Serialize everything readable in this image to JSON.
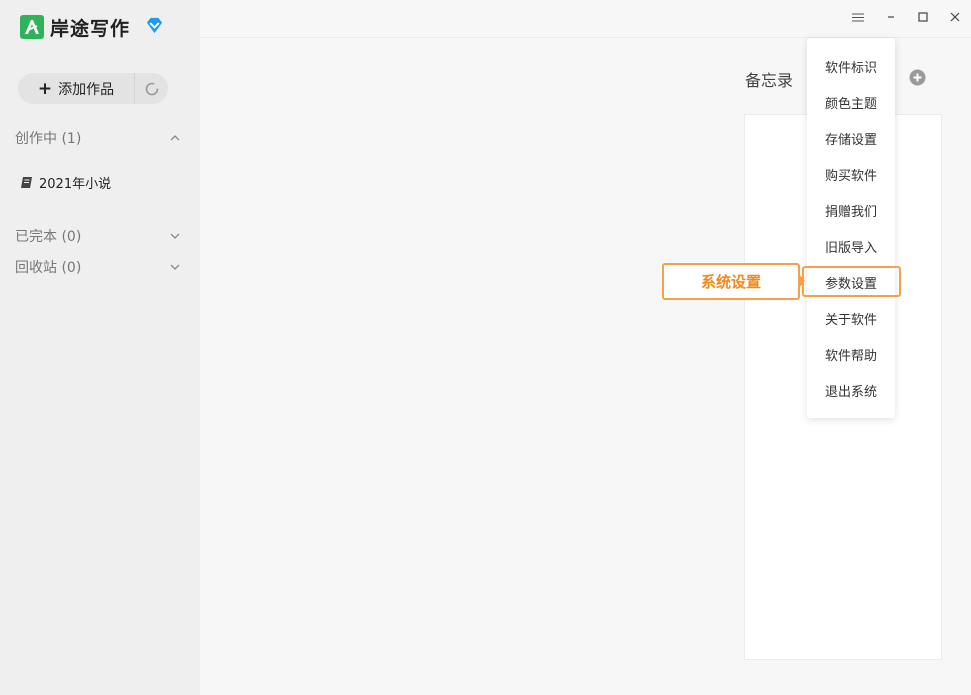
{
  "app": {
    "name": "岸途写作",
    "brand_color": "#2fb35a",
    "vip_icon": "diamond-icon"
  },
  "sidebar": {
    "add_button_label": "添加作品",
    "sections": [
      {
        "label": "创作中 (1)",
        "expanded": true
      },
      {
        "label": "已完本 (0)",
        "expanded": false
      },
      {
        "label": "回收站 (0)",
        "expanded": false
      }
    ],
    "works": [
      {
        "title": "2021年小说",
        "icon": "book-icon"
      }
    ]
  },
  "memo": {
    "title": "备忘录"
  },
  "menu": {
    "items": [
      "软件标识",
      "颜色主题",
      "存储设置",
      "购买软件",
      "捐赠我们",
      "旧版导入",
      "参数设置",
      "关于软件",
      "软件帮助",
      "退出系统"
    ],
    "highlighted": "参数设置"
  },
  "callout": {
    "text": "系统设置",
    "color": "#f08a1c"
  }
}
